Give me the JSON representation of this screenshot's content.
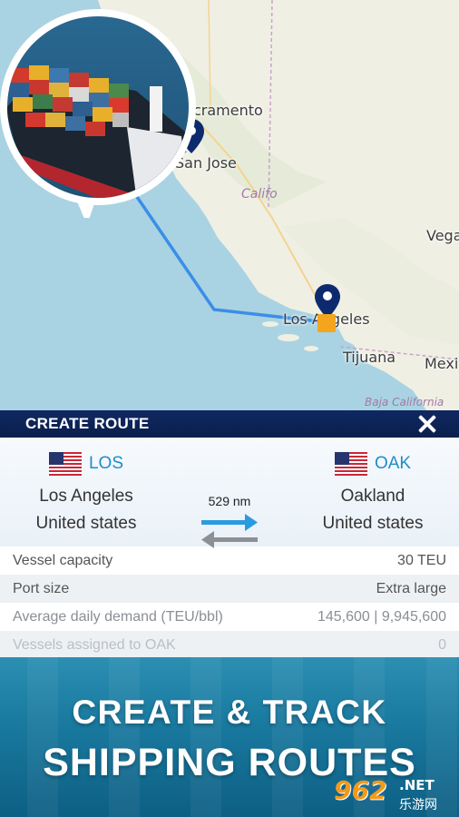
{
  "map": {
    "cities": {
      "sacramento": "Sacramento",
      "san_jose": "San Jose",
      "los_angeles": "Los Angeles",
      "tijuana": "Tijuana",
      "vegas": "Vegas",
      "mexicali": "Mexi"
    },
    "regions": {
      "california": "Califo",
      "baja_california": "Baja California"
    }
  },
  "dialog": {
    "title": "CREATE ROUTE",
    "close_icon": "close-icon",
    "distance": "529 nm",
    "from": {
      "code": "LOS",
      "city": "Los Angeles",
      "country": "United states",
      "flag": "us-flag-icon"
    },
    "to": {
      "code": "OAK",
      "city": "Oakland",
      "country": "United states",
      "flag": "us-flag-icon"
    },
    "rows": [
      {
        "label": "Vessel capacity",
        "value": "30 TEU"
      },
      {
        "label": "Port size",
        "value": "Extra large"
      },
      {
        "label": "Average daily demand (TEU/bbl)",
        "value": "145,600 | 9,945,600"
      },
      {
        "label": "Vessels assigned to OAK",
        "value": "0"
      }
    ]
  },
  "banner": {
    "line1": "CREATE & TRACK",
    "line2": "SHIPPING ROUTES"
  },
  "watermark": {
    "number": "962",
    "net": ".NET",
    "cn": "乐游网"
  },
  "colors": {
    "header": "#0f2860",
    "accent": "#1d8ec8",
    "route": "#3b8ee8",
    "pin": "#0e2a6e"
  }
}
